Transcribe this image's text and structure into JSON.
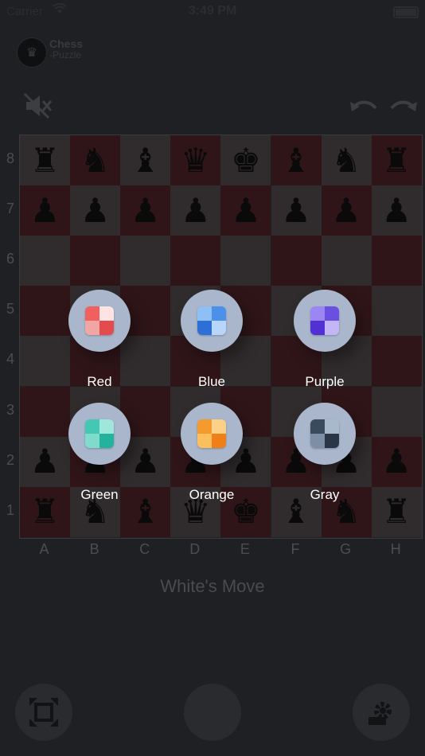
{
  "status_bar": {
    "carrier": "Carrier",
    "time": "3:49 PM"
  },
  "header": {
    "title": "Chess",
    "subtitle": "-Puzzle"
  },
  "board": {
    "ranks": [
      "8",
      "7",
      "6",
      "5",
      "4",
      "3",
      "2",
      "1"
    ],
    "files": [
      "A",
      "B",
      "C",
      "D",
      "E",
      "F",
      "G",
      "H"
    ],
    "pieces": {
      "8": [
        "♜",
        "♞",
        "♝",
        "♛",
        "♚",
        "♝",
        "♞",
        "♜"
      ],
      "7": [
        "♟",
        "♟",
        "♟",
        "♟",
        "♟",
        "♟",
        "♟",
        "♟"
      ],
      "2": [
        "♟",
        "♟",
        "♟",
        "♟",
        "♟",
        "♟",
        "♟",
        "♟"
      ],
      "1": [
        "♜",
        "♞",
        "♝",
        "♛",
        "♚",
        "♝",
        "♞",
        "♜"
      ]
    }
  },
  "move_status": "White's Move",
  "themes": [
    {
      "label": "Red",
      "colors": [
        "#f0605f",
        "#fde4e3",
        "#f2a6a4",
        "#e54a4d"
      ]
    },
    {
      "label": "Blue",
      "colors": [
        "#8ec0f6",
        "#4b91ea",
        "#2d6fd6",
        "#b7d6f8"
      ]
    },
    {
      "label": "Purple",
      "colors": [
        "#9b87f1",
        "#6a4fe0",
        "#5330d3",
        "#c2b6f6"
      ]
    },
    {
      "label": "Green",
      "colors": [
        "#42c8b3",
        "#9ee7da",
        "#7fdccc",
        "#23b39d"
      ]
    },
    {
      "label": "Orange",
      "colors": [
        "#f59a2d",
        "#fcd087",
        "#fbbf5d",
        "#ef7f17"
      ]
    },
    {
      "label": "Gray",
      "colors": [
        "#3a4b5e",
        "#a9b9cc",
        "#7c8fa5",
        "#2a3646"
      ]
    }
  ]
}
